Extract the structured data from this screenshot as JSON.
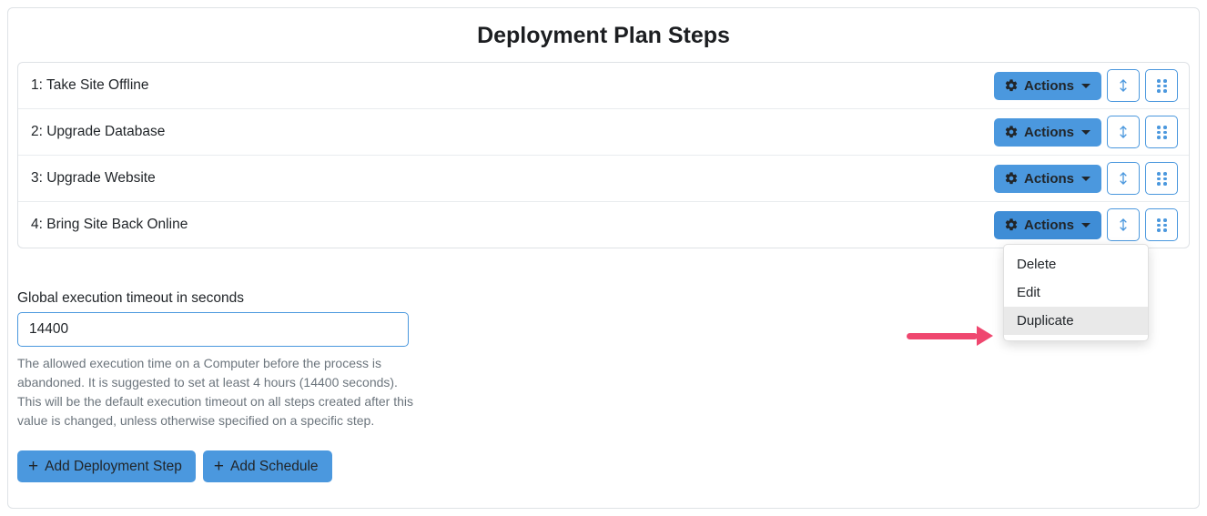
{
  "title": "Deployment Plan Steps",
  "actions_label": "Actions",
  "steps": [
    {
      "label": "1: Take Site Offline"
    },
    {
      "label": "2: Upgrade Database"
    },
    {
      "label": "3: Upgrade Website"
    },
    {
      "label": "4: Bring Site Back Online"
    }
  ],
  "dropdown": {
    "delete": "Delete",
    "edit": "Edit",
    "duplicate": "Duplicate"
  },
  "timeout": {
    "label": "Global execution timeout in seconds",
    "value": "14400",
    "help": "The allowed execution time on a Computer before the process is abandoned. It is suggested to set at least 4 hours (14400 seconds). This will be the default execution timeout on all steps created after this value is changed, unless otherwise specified on a specific step."
  },
  "buttons": {
    "add_step": "Add Deployment Step",
    "add_schedule": "Add Schedule"
  }
}
